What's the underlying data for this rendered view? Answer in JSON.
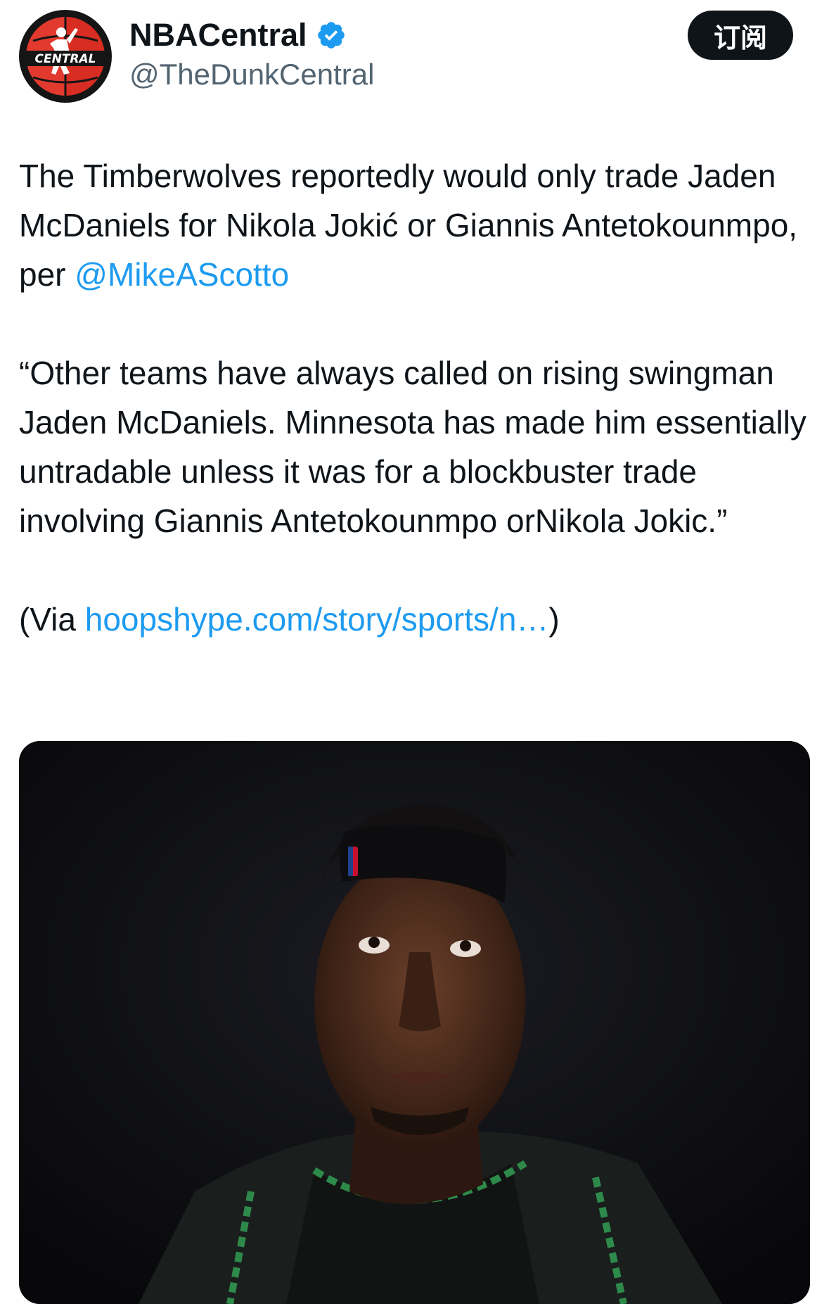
{
  "author": {
    "display_name": "NBACentral",
    "handle": "@TheDunkCentral",
    "avatar_text": "CENTRAL"
  },
  "header": {
    "subscribe_label": "订阅"
  },
  "tweet": {
    "line1_text": "The Timberwolves reportedly would only trade Jaden McDaniels for Nikola Jokić or Giannis Antetokounmpo, per ",
    "mention": "@MikeAScotto",
    "quote": "“Other teams have always called on rising swingman Jaden McDaniels. Minnesota has made him essentially untradable unless it was for a blockbuster trade involving Giannis Antetokounmpo orNikola Jokic.”",
    "via_prefix": "(Via ",
    "via_link": "hoopshype.com/story/sports/n…",
    "via_suffix": ")"
  },
  "colors": {
    "text": "#0f1419",
    "secondary": "#536471",
    "link": "#1d9bf0",
    "verified": "#1d9bf0",
    "button_bg": "#0f1419"
  },
  "icons": {
    "verified": "verified-badge-icon",
    "avatar": "nba-central-logo"
  }
}
